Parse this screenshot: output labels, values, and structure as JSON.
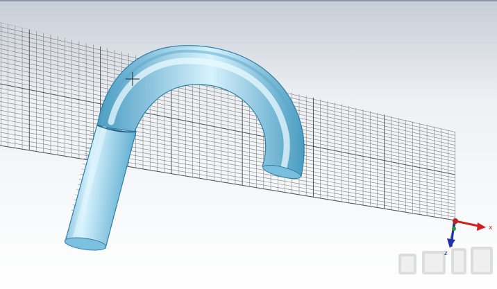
{
  "viewport": {
    "background_top": "#c6cdd6",
    "background_bottom": "#ffffff",
    "grid_color": "#7a7a7a",
    "grid_major_color": "#555555"
  },
  "model": {
    "tube_color": "#8ed0ea",
    "tube_highlight": "#e4f7ff",
    "tube_shadow": "#3f93b8"
  },
  "axes": {
    "x_label": "x",
    "z_label": "z",
    "x_color": "#d02020",
    "y_color": "#2a9a2a",
    "z_color": "#2030b0"
  },
  "icons": {
    "cursor": "crosshair-cursor-icon",
    "axes": "coordinate-axes-icon",
    "watermark": "watermark-logo"
  }
}
